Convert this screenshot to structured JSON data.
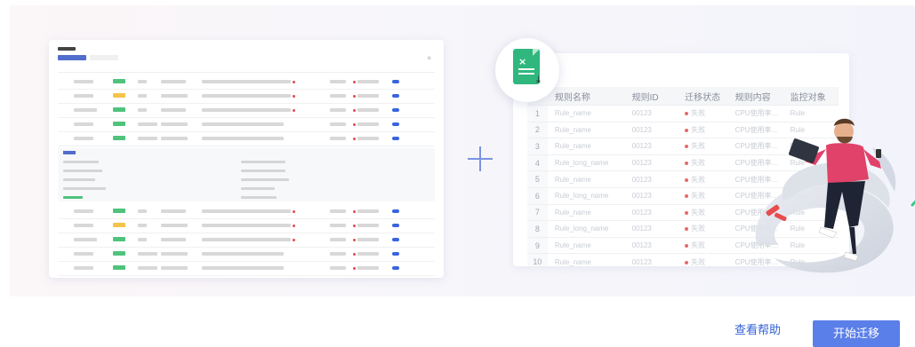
{
  "table": {
    "headers": [
      "",
      "规则名称",
      "规则ID",
      "迁移状态",
      "规则内容",
      "监控对象"
    ],
    "rows": [
      {
        "num": "1",
        "name": "Rule_name",
        "id": "00123",
        "status": "失败",
        "content": "CPU使用率…",
        "target": "Rule"
      },
      {
        "num": "2",
        "name": "Rule_name",
        "id": "00123",
        "status": "失败",
        "content": "CPU使用率…",
        "target": "Rule"
      },
      {
        "num": "3",
        "name": "Rule_name",
        "id": "00123",
        "status": "失败",
        "content": "CPU使用率…",
        "target": "Rule"
      },
      {
        "num": "4",
        "name": "Rule_long_name",
        "id": "00123",
        "status": "失败",
        "content": "CPU使用率…",
        "target": "Rule"
      },
      {
        "num": "5",
        "name": "Rule_name",
        "id": "00123",
        "status": "失败",
        "content": "CPU使用率…",
        "target": "Rule"
      },
      {
        "num": "6",
        "name": "Rule_long_name",
        "id": "00123",
        "status": "失败",
        "content": "CPU使用率…",
        "target": "Rule"
      },
      {
        "num": "7",
        "name": "Rule_name",
        "id": "00123",
        "status": "失败",
        "content": "CPU使用率…",
        "target": "Rule"
      },
      {
        "num": "8",
        "name": "Rule_long_name",
        "id": "00123",
        "status": "失败",
        "content": "CPU使用率…",
        "target": "Rule"
      },
      {
        "num": "9",
        "name": "Rule_name",
        "id": "00123",
        "status": "失败",
        "content": "CPU使用率…",
        "target": "Rule"
      },
      {
        "num": "10",
        "name": "Rule_name",
        "id": "00123",
        "status": "失败",
        "content": "CPU使用率…",
        "target": "Rule"
      }
    ]
  },
  "footer": {
    "help_link": "查看帮助",
    "start_button": "开始迁移"
  },
  "colors": {
    "accent": "#5a7fe8",
    "link": "#3460d6",
    "excel_green": "#2fb77d"
  }
}
